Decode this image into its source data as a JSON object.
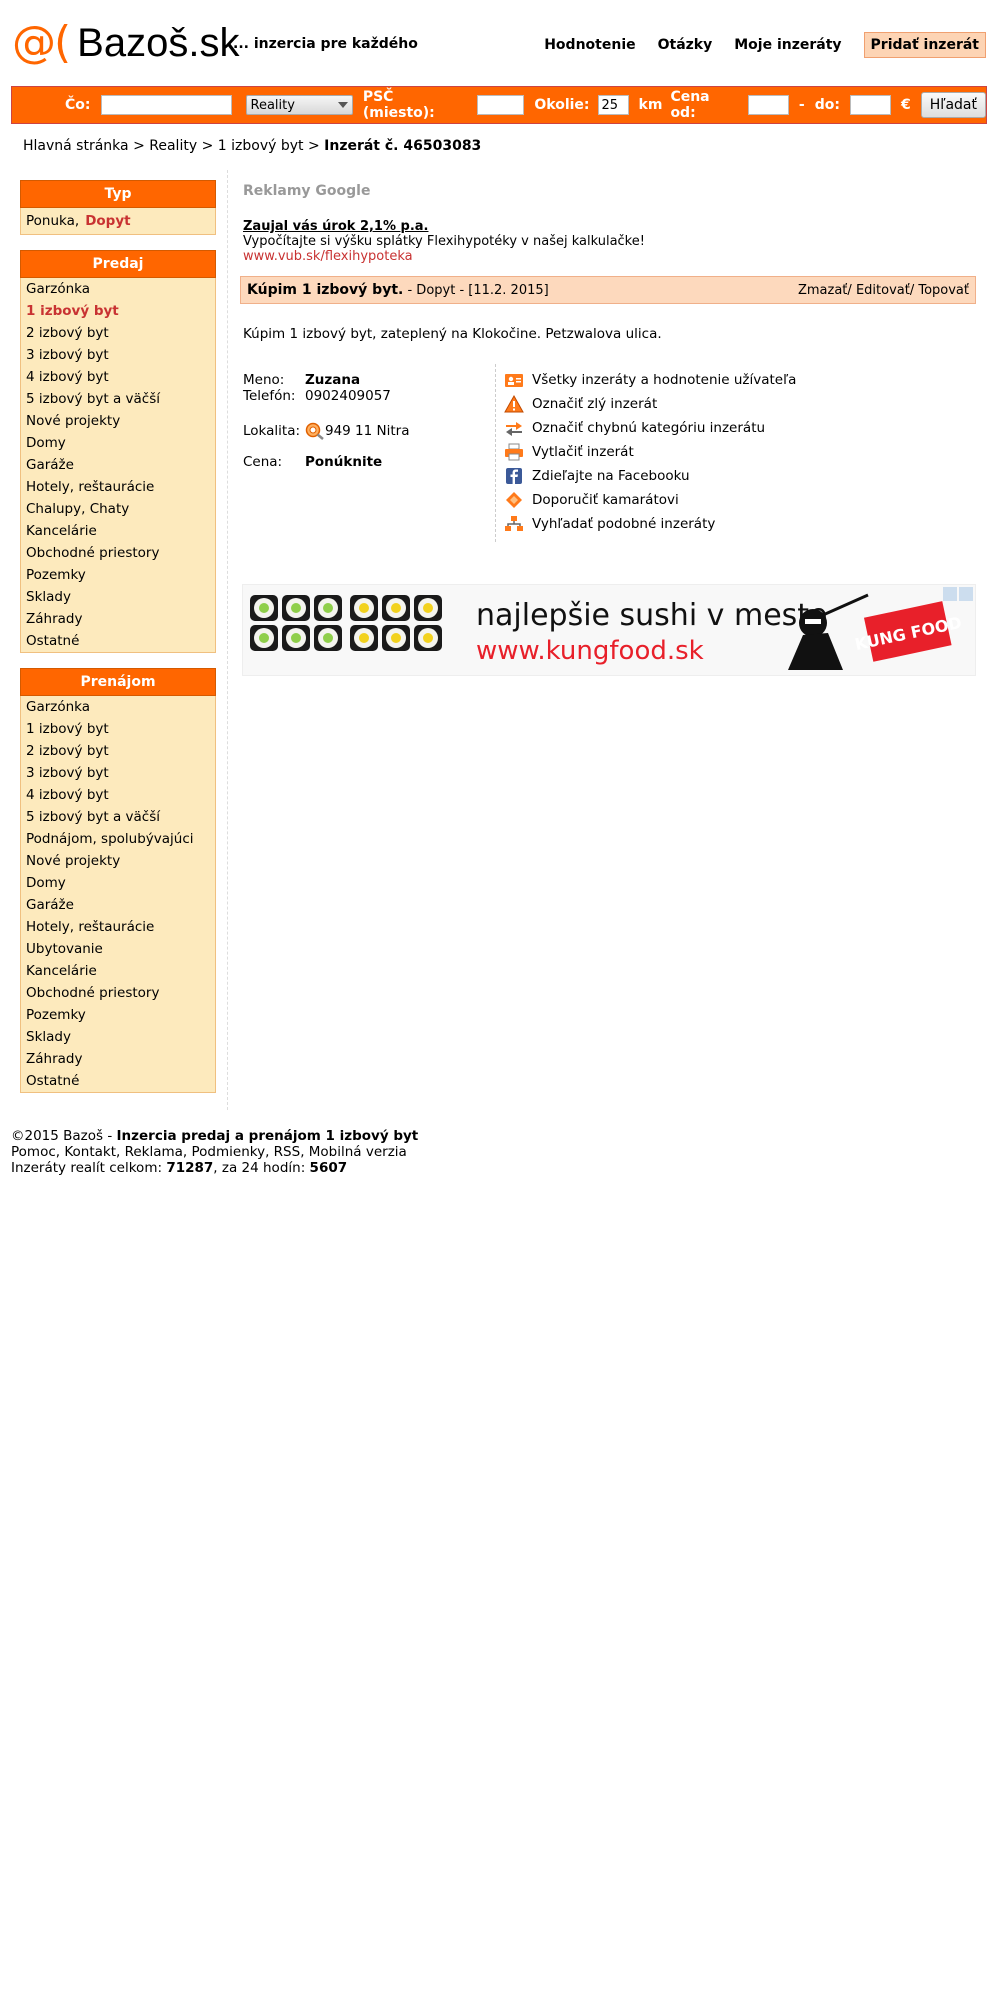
{
  "header": {
    "logo_at": "@(",
    "logo_text": "Bazoš.sk",
    "tagline": "... inzercia pre každého",
    "nav": [
      "Hodnotenie",
      "Otázky",
      "Moje inzeráty"
    ],
    "add_button": "Pridať inzerát"
  },
  "search": {
    "co_label": "Čo:",
    "co_value": "",
    "category": "Reality",
    "psc_label": "PSČ (miesto):",
    "psc_value": "",
    "okolie_label": "Okolie:",
    "okolie_value": "25",
    "km_label": "km",
    "cena_label": "Cena od:",
    "cena_od": "",
    "dash": "-",
    "do_label": "do:",
    "cena_do": "",
    "currency": "€",
    "button": "Hľadať"
  },
  "breadcrumb": {
    "items": [
      "Hlavná stránka",
      "Reality",
      "1 izbový byt"
    ],
    "sep": ">",
    "current": "Inzerát č. 46503083"
  },
  "sidebar": {
    "typ": {
      "title": "Typ",
      "ponuka": "Ponuka,",
      "dopyt": "Dopyt"
    },
    "predaj": {
      "title": "Predaj",
      "items": [
        "Garzónka",
        "1 izbový byt",
        "2 izbový byt",
        "3 izbový byt",
        "4 izbový byt",
        "5 izbový byt a väčší",
        "Nové projekty",
        "Domy",
        "Garáže",
        "Hotely, reštaurácie",
        "Chalupy, Chaty",
        "Kancelárie",
        "Obchodné priestory",
        "Pozemky",
        "Sklady",
        "Záhrady",
        "Ostatné"
      ]
    },
    "prenajom": {
      "title": "Prenájom",
      "items": [
        "Garzónka",
        "1 izbový byt",
        "2 izbový byt",
        "3 izbový byt",
        "4 izbový byt",
        "5 izbový byt a väčší",
        "Podnájom, spolubývajúci",
        "Nové projekty",
        "Domy",
        "Garáže",
        "Hotely, reštaurácie",
        "Ubytovanie",
        "Kancelárie",
        "Obchodné priestory",
        "Pozemky",
        "Sklady",
        "Záhrady",
        "Ostatné"
      ]
    }
  },
  "ads": {
    "label": "Reklamy Google",
    "title": "Zaujal vás úrok 2,1% p.a.",
    "text": "Vypočítajte si výšku splátky Flexihypotéky v našej kalkulačke!",
    "url": "www.vub.sk/flexihypoteka"
  },
  "listing": {
    "title": "Kúpim 1 izbový byt.",
    "meta": "- Dopyt - [11.2. 2015]",
    "actions": [
      "Zmazať/",
      "Editovať/",
      "Topovať"
    ],
    "description": "Kúpim 1 izbový byt, zateplený na Klokočine. Petzwalova ulica.",
    "meno_label": "Meno:",
    "meno": "Zuzana",
    "telefon_label": "Telefón:",
    "telefon": "0902409057",
    "lokalita_label": "Lokalita:",
    "lokalita": "949 11 Nitra",
    "cena_label": "Cena:",
    "cena": "Ponúknite",
    "links": [
      {
        "icon": "user-listings-icon",
        "label": "Všetky inzeráty a hodnotenie užívateľa"
      },
      {
        "icon": "warning-icon",
        "label": "Označiť zlý inzerát"
      },
      {
        "icon": "swap-arrows-icon",
        "label": "Označiť chybnú kategóriu inzerátu"
      },
      {
        "icon": "printer-icon",
        "label": "Vytlačiť inzerát"
      },
      {
        "icon": "facebook-icon",
        "label": "Zdieľajte na Facebooku"
      },
      {
        "icon": "recommend-icon",
        "label": "Doporučiť kamarátovi"
      },
      {
        "icon": "similar-search-icon",
        "label": "Vyhľadať podobné inzeráty"
      }
    ]
  },
  "banner": {
    "headline": "najlepšie sushi v meste",
    "url": "www.kungfood.sk",
    "brand": "KUNG FOOD"
  },
  "footer": {
    "copyright": "©2015 Bazoš -",
    "copyright_bold": "Inzercia predaj a prenájom 1 izbový byt",
    "links": "Pomoc, Kontakt, Reklama, Podmienky, RSS, Mobilná verzia",
    "stats_prefix": "Inzeráty realít celkom:",
    "total": "71287",
    "stats_mid": ", za 24 hodín:",
    "day": "5607"
  },
  "colors": {
    "accent": "#ff6600",
    "sidebar_bg": "#fdeabd",
    "active": "#c83232",
    "listing_bar": "#fdd9bd"
  }
}
